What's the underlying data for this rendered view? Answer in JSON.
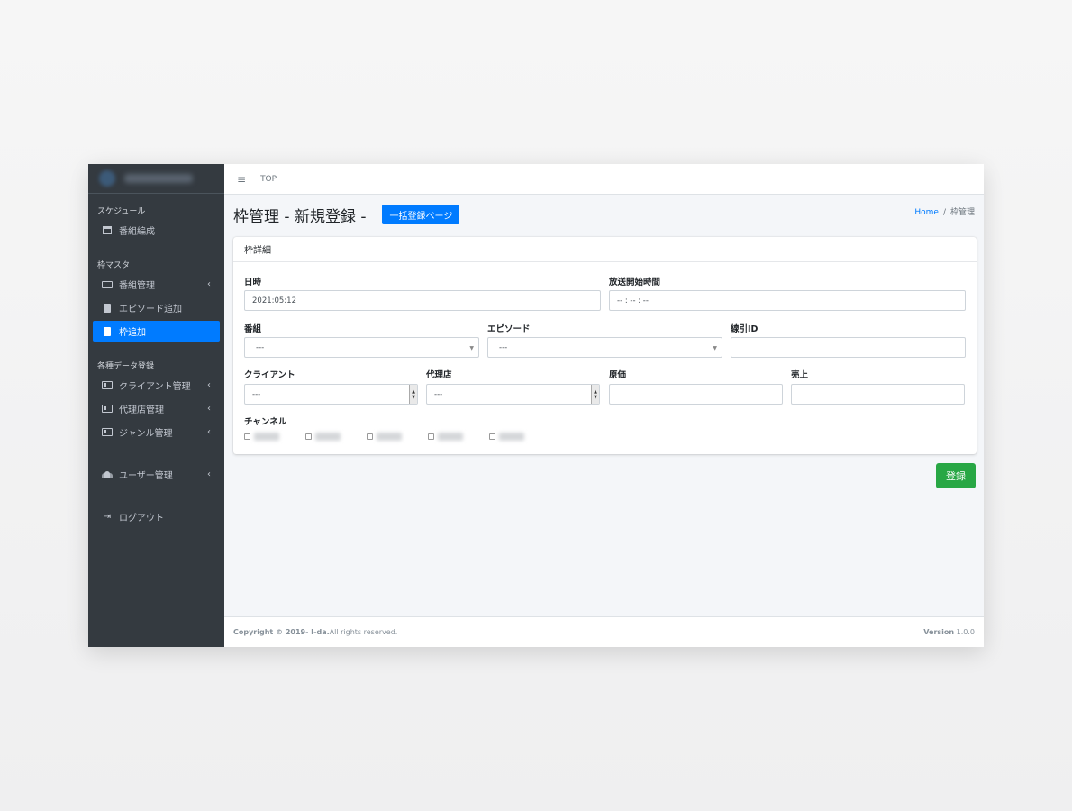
{
  "sidebar": {
    "sections": [
      {
        "header": "スケジュール",
        "items": [
          {
            "label": "番組編成",
            "icon": "calendar-icon"
          }
        ]
      },
      {
        "header": "枠マスタ",
        "items": [
          {
            "label": "番組管理",
            "icon": "monitor-icon"
          },
          {
            "label": "エピソード追加",
            "icon": "book-icon"
          },
          {
            "label": "枠追加",
            "icon": "book-icon",
            "active": true
          }
        ]
      },
      {
        "header": "各種データ登録",
        "items": [
          {
            "label": "クライアント管理",
            "icon": "id-card-icon"
          },
          {
            "label": "代理店管理",
            "icon": "id-card-icon"
          },
          {
            "label": "ジャンル管理",
            "icon": "id-card-icon"
          }
        ]
      },
      {
        "header": "",
        "items": [
          {
            "label": "ユーザー管理",
            "icon": "users-icon"
          }
        ]
      },
      {
        "header": "",
        "items": [
          {
            "label": "ログアウト",
            "icon": "logout-icon"
          }
        ]
      }
    ],
    "chevron": "‹"
  },
  "topbar": {
    "menu_icon": "≡",
    "top_link": "TOP"
  },
  "page": {
    "title": "枠管理 - 新規登録 -",
    "bulk_button": "一括登録ページ",
    "breadcrumb": {
      "home": "Home",
      "sep": "/",
      "current": "枠管理"
    }
  },
  "card": {
    "title": "枠詳細",
    "fields": {
      "datetime": {
        "label": "日時",
        "value": "2021:05:12"
      },
      "start_time": {
        "label": "放送開始時間",
        "value": "-- : -- : --"
      },
      "program": {
        "label": "番組",
        "value": "---"
      },
      "episode": {
        "label": "エピソード",
        "value": "---"
      },
      "line_id": {
        "label": "線引ID",
        "value": ""
      },
      "client": {
        "label": "クライアント",
        "value": "---"
      },
      "agency": {
        "label": "代理店",
        "value": "---"
      },
      "cost": {
        "label": "原価",
        "value": ""
      },
      "sales": {
        "label": "売上",
        "value": ""
      },
      "channel": {
        "label": "チャンネル"
      }
    }
  },
  "submit_label": "登録",
  "footer": {
    "copyright": "Copyright © 2019- I-da.",
    "rights": " All rights reserved.",
    "version_label": "Version",
    "version_value": " 1.0.0"
  },
  "colors": {
    "sidebar_bg": "#343a40",
    "accent": "#007bff",
    "success": "#28a745"
  }
}
